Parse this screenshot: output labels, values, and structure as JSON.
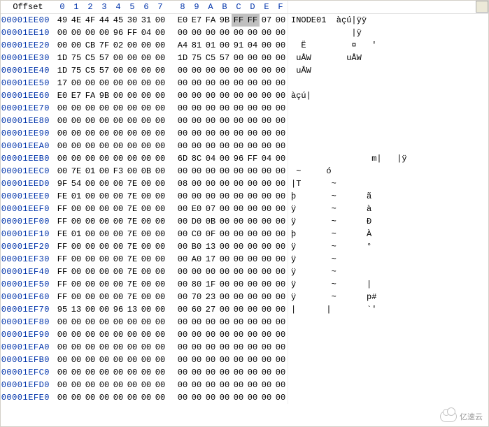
{
  "header": {
    "offset_label": "Offset",
    "cols": [
      "0",
      "1",
      "2",
      "3",
      "4",
      "5",
      "6",
      "7",
      "8",
      "9",
      "A",
      "B",
      "C",
      "D",
      "E",
      "F"
    ]
  },
  "rows": [
    {
      "offset": "00001EE00",
      "hex": [
        "49",
        "4E",
        "4F",
        "44",
        "45",
        "30",
        "31",
        "00",
        "E0",
        "E7",
        "FA",
        "9B",
        "FF",
        "FF",
        "07",
        "00"
      ],
      "ascii": "INODE01  àçú|ÿÿ"
    },
    {
      "offset": "00001EE10",
      "hex": [
        "00",
        "00",
        "00",
        "00",
        "96",
        "FF",
        "04",
        "00",
        "00",
        "00",
        "00",
        "00",
        "00",
        "00",
        "00",
        "00"
      ],
      "ascii": "            |ÿ"
    },
    {
      "offset": "00001EE20",
      "hex": [
        "00",
        "00",
        "CB",
        "7F",
        "02",
        "00",
        "00",
        "00",
        "A4",
        "81",
        "01",
        "00",
        "91",
        "04",
        "00",
        "00"
      ],
      "ascii": "  Ë         ¤   '"
    },
    {
      "offset": "00001EE30",
      "hex": [
        "1D",
        "75",
        "C5",
        "57",
        "00",
        "00",
        "00",
        "00",
        "1D",
        "75",
        "C5",
        "57",
        "00",
        "00",
        "00",
        "00"
      ],
      "ascii": " uÅW       uÅW"
    },
    {
      "offset": "00001EE40",
      "hex": [
        "1D",
        "75",
        "C5",
        "57",
        "00",
        "00",
        "00",
        "00",
        "00",
        "00",
        "00",
        "00",
        "00",
        "00",
        "00",
        "00"
      ],
      "ascii": " uÅW"
    },
    {
      "offset": "00001EE50",
      "hex": [
        "17",
        "00",
        "00",
        "00",
        "00",
        "00",
        "00",
        "00",
        "00",
        "00",
        "00",
        "00",
        "00",
        "00",
        "00",
        "00"
      ],
      "ascii": ""
    },
    {
      "offset": "00001EE60",
      "hex": [
        "E0",
        "E7",
        "FA",
        "9B",
        "00",
        "00",
        "00",
        "00",
        "00",
        "00",
        "00",
        "00",
        "00",
        "00",
        "00",
        "00"
      ],
      "ascii": "àçú|"
    },
    {
      "offset": "00001EE70",
      "hex": [
        "00",
        "00",
        "00",
        "00",
        "00",
        "00",
        "00",
        "00",
        "00",
        "00",
        "00",
        "00",
        "00",
        "00",
        "00",
        "00"
      ],
      "ascii": ""
    },
    {
      "offset": "00001EE80",
      "hex": [
        "00",
        "00",
        "00",
        "00",
        "00",
        "00",
        "00",
        "00",
        "00",
        "00",
        "00",
        "00",
        "00",
        "00",
        "00",
        "00"
      ],
      "ascii": ""
    },
    {
      "offset": "00001EE90",
      "hex": [
        "00",
        "00",
        "00",
        "00",
        "00",
        "00",
        "00",
        "00",
        "00",
        "00",
        "00",
        "00",
        "00",
        "00",
        "00",
        "00"
      ],
      "ascii": ""
    },
    {
      "offset": "00001EEA0",
      "hex": [
        "00",
        "00",
        "00",
        "00",
        "00",
        "00",
        "00",
        "00",
        "00",
        "00",
        "00",
        "00",
        "00",
        "00",
        "00",
        "00"
      ],
      "ascii": ""
    },
    {
      "offset": "00001EEB0",
      "hex": [
        "00",
        "00",
        "00",
        "00",
        "00",
        "00",
        "00",
        "00",
        "6D",
        "8C",
        "04",
        "00",
        "96",
        "FF",
        "04",
        "00"
      ],
      "ascii": "                m|   |ÿ"
    },
    {
      "offset": "00001EEC0",
      "hex": [
        "00",
        "7E",
        "01",
        "00",
        "F3",
        "00",
        "0B",
        "00",
        "00",
        "00",
        "00",
        "00",
        "00",
        "00",
        "00",
        "00"
      ],
      "ascii": " ~     ó"
    },
    {
      "offset": "00001EED0",
      "hex": [
        "9F",
        "54",
        "00",
        "00",
        "00",
        "7E",
        "00",
        "00",
        "08",
        "00",
        "00",
        "00",
        "00",
        "00",
        "00",
        "00"
      ],
      "ascii": "|T      ~"
    },
    {
      "offset": "00001EEE0",
      "hex": [
        "FE",
        "01",
        "00",
        "00",
        "00",
        "7E",
        "00",
        "00",
        "00",
        "00",
        "00",
        "00",
        "00",
        "00",
        "00",
        "00"
      ],
      "ascii": "þ       ~      ã"
    },
    {
      "offset": "00001EEF0",
      "hex": [
        "FF",
        "00",
        "00",
        "00",
        "00",
        "7E",
        "00",
        "00",
        "00",
        "E0",
        "07",
        "00",
        "00",
        "00",
        "00",
        "00"
      ],
      "ascii": "ÿ       ~      à"
    },
    {
      "offset": "00001EF00",
      "hex": [
        "FF",
        "00",
        "00",
        "00",
        "00",
        "7E",
        "00",
        "00",
        "00",
        "D0",
        "0B",
        "00",
        "00",
        "00",
        "00",
        "00"
      ],
      "ascii": "ÿ       ~      Ð"
    },
    {
      "offset": "00001EF10",
      "hex": [
        "FE",
        "01",
        "00",
        "00",
        "00",
        "7E",
        "00",
        "00",
        "00",
        "C0",
        "0F",
        "00",
        "00",
        "00",
        "00",
        "00"
      ],
      "ascii": "þ       ~      À"
    },
    {
      "offset": "00001EF20",
      "hex": [
        "FF",
        "00",
        "00",
        "00",
        "00",
        "7E",
        "00",
        "00",
        "00",
        "B0",
        "13",
        "00",
        "00",
        "00",
        "00",
        "00"
      ],
      "ascii": "ÿ       ~      °"
    },
    {
      "offset": "00001EF30",
      "hex": [
        "FF",
        "00",
        "00",
        "00",
        "00",
        "7E",
        "00",
        "00",
        "00",
        "A0",
        "17",
        "00",
        "00",
        "00",
        "00",
        "00"
      ],
      "ascii": "ÿ       ~"
    },
    {
      "offset": "00001EF40",
      "hex": [
        "FF",
        "00",
        "00",
        "00",
        "00",
        "7E",
        "00",
        "00",
        "00",
        "00",
        "00",
        "00",
        "00",
        "00",
        "00",
        "00"
      ],
      "ascii": "ÿ       ~"
    },
    {
      "offset": "00001EF50",
      "hex": [
        "FF",
        "00",
        "00",
        "00",
        "00",
        "7E",
        "00",
        "00",
        "00",
        "80",
        "1F",
        "00",
        "00",
        "00",
        "00",
        "00"
      ],
      "ascii": "ÿ       ~      |"
    },
    {
      "offset": "00001EF60",
      "hex": [
        "FF",
        "00",
        "00",
        "00",
        "00",
        "7E",
        "00",
        "00",
        "00",
        "70",
        "23",
        "00",
        "00",
        "00",
        "00",
        "00"
      ],
      "ascii": "ÿ       ~      p#"
    },
    {
      "offset": "00001EF70",
      "hex": [
        "95",
        "13",
        "00",
        "00",
        "96",
        "13",
        "00",
        "00",
        "00",
        "60",
        "27",
        "00",
        "00",
        "00",
        "00",
        "00"
      ],
      "ascii": "|      |       `'"
    },
    {
      "offset": "00001EF80",
      "hex": [
        "00",
        "00",
        "00",
        "00",
        "00",
        "00",
        "00",
        "00",
        "00",
        "00",
        "00",
        "00",
        "00",
        "00",
        "00",
        "00"
      ],
      "ascii": ""
    },
    {
      "offset": "00001EF90",
      "hex": [
        "00",
        "00",
        "00",
        "00",
        "00",
        "00",
        "00",
        "00",
        "00",
        "00",
        "00",
        "00",
        "00",
        "00",
        "00",
        "00"
      ],
      "ascii": ""
    },
    {
      "offset": "00001EFA0",
      "hex": [
        "00",
        "00",
        "00",
        "00",
        "00",
        "00",
        "00",
        "00",
        "00",
        "00",
        "00",
        "00",
        "00",
        "00",
        "00",
        "00"
      ],
      "ascii": ""
    },
    {
      "offset": "00001EFB0",
      "hex": [
        "00",
        "00",
        "00",
        "00",
        "00",
        "00",
        "00",
        "00",
        "00",
        "00",
        "00",
        "00",
        "00",
        "00",
        "00",
        "00"
      ],
      "ascii": ""
    },
    {
      "offset": "00001EFC0",
      "hex": [
        "00",
        "00",
        "00",
        "00",
        "00",
        "00",
        "00",
        "00",
        "00",
        "00",
        "00",
        "00",
        "00",
        "00",
        "00",
        "00"
      ],
      "ascii": ""
    },
    {
      "offset": "00001EFD0",
      "hex": [
        "00",
        "00",
        "00",
        "00",
        "00",
        "00",
        "00",
        "00",
        "00",
        "00",
        "00",
        "00",
        "00",
        "00",
        "00",
        "00"
      ],
      "ascii": ""
    },
    {
      "offset": "00001EFE0",
      "hex": [
        "00",
        "00",
        "00",
        "00",
        "00",
        "00",
        "00",
        "00",
        "00",
        "00",
        "00",
        "00",
        "00",
        "00",
        "00",
        "00"
      ],
      "ascii": ""
    }
  ],
  "selection": {
    "row": 0,
    "start": 12,
    "end": 13
  },
  "watermark": "亿速云"
}
